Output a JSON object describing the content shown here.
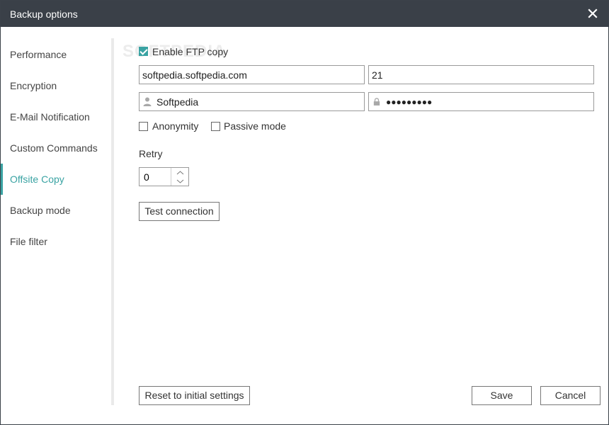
{
  "window": {
    "title": "Backup options"
  },
  "sidebar": {
    "items": [
      {
        "label": "Performance"
      },
      {
        "label": "Encryption"
      },
      {
        "label": "E-Mail Notification"
      },
      {
        "label": "Custom Commands"
      },
      {
        "label": "Offsite Copy",
        "active": true
      },
      {
        "label": "Backup mode"
      },
      {
        "label": "File filter"
      }
    ]
  },
  "ftp": {
    "enable_label": "Enable FTP copy",
    "enabled": true,
    "host": "softpedia.softpedia.com",
    "port": "21",
    "username": "Softpedia",
    "password": "●●●●●●●●●",
    "anonymity_label": "Anonymity",
    "passive_label": "Passive mode",
    "retry_label": "Retry",
    "retry_value": "0",
    "test_button": "Test connection"
  },
  "footer": {
    "reset_button": "Reset to initial settings",
    "save_button": "Save",
    "cancel_button": "Cancel"
  },
  "watermark": "SOFTPEDIA",
  "colors": {
    "accent": "#3aa3a3",
    "titlebar": "#3a4048"
  },
  "icons": {
    "close": "close-icon",
    "user": "user-icon",
    "lock": "lock-icon"
  }
}
